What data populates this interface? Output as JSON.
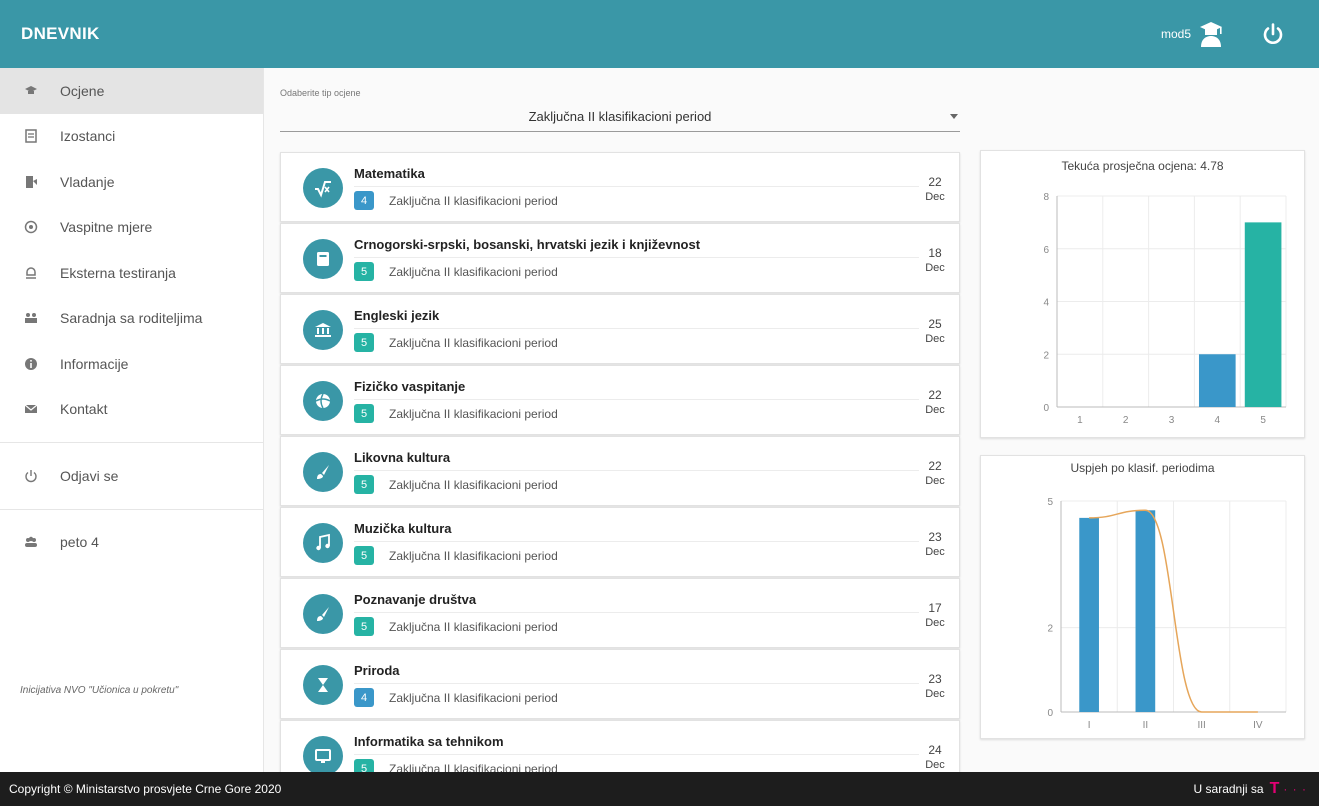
{
  "header": {
    "brand": "DNEVNIK",
    "username": "mod5"
  },
  "sidebar": {
    "items": [
      {
        "label": "Ocjene",
        "icon": "grades-icon",
        "active": true
      },
      {
        "label": "Izostanci",
        "icon": "absence-icon"
      },
      {
        "label": "Vladanje",
        "icon": "behavior-icon"
      },
      {
        "label": "Vaspitne mjere",
        "icon": "measures-icon"
      },
      {
        "label": "Eksterna testiranja",
        "icon": "testing-icon"
      },
      {
        "label": "Saradnja sa roditeljima",
        "icon": "parents-icon"
      },
      {
        "label": "Informacije",
        "icon": "info-icon"
      },
      {
        "label": "Kontakt",
        "icon": "mail-icon"
      }
    ],
    "logout_label": "Odjavi se",
    "class_label": "peto 4",
    "initiative": "Inicijativa NVO \"Učionica u pokretu\""
  },
  "filter": {
    "label": "Odaberite tip ocjene",
    "value": "Zaključna II klasifikacioni period"
  },
  "grades": [
    {
      "subject": "Matematika",
      "grade": "4",
      "period": "Zaključna II klasifikacioni period",
      "day": "22",
      "month": "Dec",
      "icon": "sqrt-icon"
    },
    {
      "subject": "Crnogorski-srpski, bosanski, hrvatski jezik i književnost",
      "grade": "5",
      "period": "Zaključna II klasifikacioni period",
      "day": "18",
      "month": "Dec",
      "icon": "book-icon"
    },
    {
      "subject": "Engleski jezik",
      "grade": "5",
      "period": "Zaključna II klasifikacioni period",
      "day": "25",
      "month": "Dec",
      "icon": "bank-icon"
    },
    {
      "subject": "Fizičko vaspitanje",
      "grade": "5",
      "period": "Zaključna II klasifikacioni period",
      "day": "22",
      "month": "Dec",
      "icon": "ball-icon"
    },
    {
      "subject": "Likovna kultura",
      "grade": "5",
      "period": "Zaključna II klasifikacioni period",
      "day": "22",
      "month": "Dec",
      "icon": "brush-icon"
    },
    {
      "subject": "Muzička kultura",
      "grade": "5",
      "period": "Zaključna II klasifikacioni period",
      "day": "23",
      "month": "Dec",
      "icon": "music-icon"
    },
    {
      "subject": "Poznavanje društva",
      "grade": "5",
      "period": "Zaključna II klasifikacioni period",
      "day": "17",
      "month": "Dec",
      "icon": "brush-icon"
    },
    {
      "subject": "Priroda",
      "grade": "4",
      "period": "Zaključna II klasifikacioni period",
      "day": "23",
      "month": "Dec",
      "icon": "hourglass-icon"
    },
    {
      "subject": "Informatika sa tehnikom",
      "grade": "5",
      "period": "Zaključna II klasifikacioni period",
      "day": "24",
      "month": "Dec",
      "icon": "monitor-icon"
    }
  ],
  "chart_data": [
    {
      "type": "bar",
      "title": "Tekuća prosječna ocjena: 4.78",
      "categories": [
        "1",
        "2",
        "3",
        "4",
        "5"
      ],
      "values": [
        0,
        0,
        0,
        2,
        7
      ],
      "colors": [
        "#3a97c9",
        "#3a97c9",
        "#3a97c9",
        "#3a97c9",
        "#26b3a4"
      ],
      "yticks": [
        "0",
        "2",
        "4",
        "6",
        "8"
      ],
      "ylim": [
        0,
        8
      ],
      "grid": true
    },
    {
      "type": "bar",
      "title": "Uspjeh po klasif. periodima",
      "categories": [
        "I",
        "II",
        "III",
        "IV"
      ],
      "values": [
        4.6,
        4.78,
        0,
        0
      ],
      "line_values": [
        4.6,
        4.78,
        0,
        0
      ],
      "colors": [
        "#3a97c9"
      ],
      "line_color": "#e6a65a",
      "yticks": [
        "0",
        "2",
        "5"
      ],
      "ylim": [
        0,
        5
      ],
      "grid": true
    }
  ],
  "footer": {
    "copyright": "Copyright © Ministarstvo prosvjete Crne Gore 2020",
    "partner": "U saradnji sa",
    "partner_logo": "T",
    "partner_dots": "· · ·"
  },
  "theme": {
    "primary": "#3a97a7",
    "grade4": "#3a97c9",
    "grade5": "#26b3a4"
  }
}
